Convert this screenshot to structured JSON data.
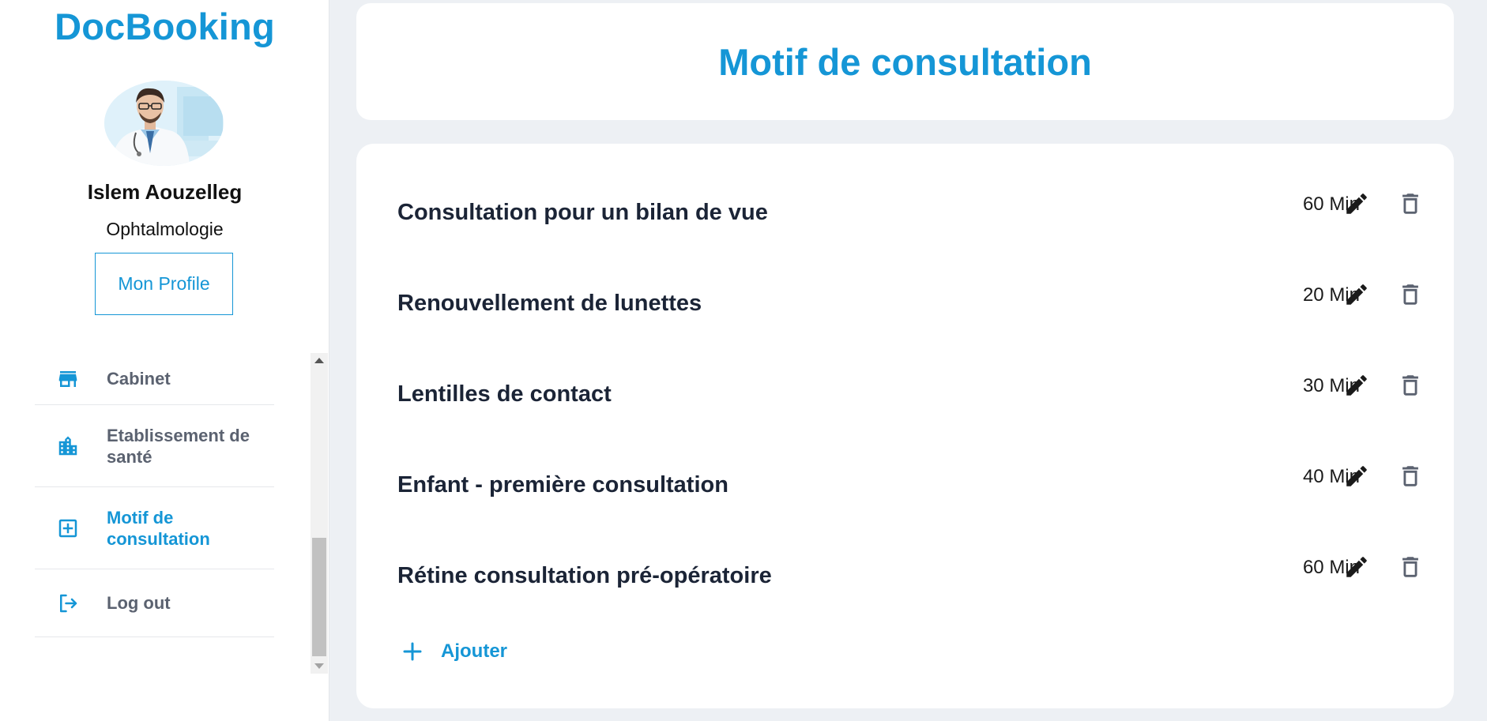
{
  "brand": "DocBooking",
  "doctor": {
    "name": "Islem Aouzelleg",
    "specialty": "Ophtalmologie"
  },
  "profile_button": "Mon Profile",
  "nav": {
    "items": [
      {
        "label": "Cabinet",
        "icon": "store-icon",
        "active": false
      },
      {
        "label": "Etablissement de santé",
        "icon": "building-icon",
        "active": false
      },
      {
        "label": "Motif de consultation",
        "icon": "plus-box-icon",
        "active": true
      },
      {
        "label": "Log out",
        "icon": "logout-icon",
        "active": false
      }
    ]
  },
  "page": {
    "title": "Motif de consultation"
  },
  "motifs": [
    {
      "title": "Consultation pour un bilan de vue",
      "duration": "60 Min"
    },
    {
      "title": "Renouvellement de lunettes",
      "duration": "20 Min"
    },
    {
      "title": "Lentilles de contact",
      "duration": "30 Min"
    },
    {
      "title": "Enfant - première consultation",
      "duration": "40 Min"
    },
    {
      "title": "Rétine consultation pré-opératoire",
      "duration": "60 Min"
    }
  ],
  "add_label": "Ajouter",
  "colors": {
    "accent": "#1596d6",
    "background": "#edf0f4",
    "text_dark": "#1b2436",
    "nav_text": "#5b6270"
  }
}
